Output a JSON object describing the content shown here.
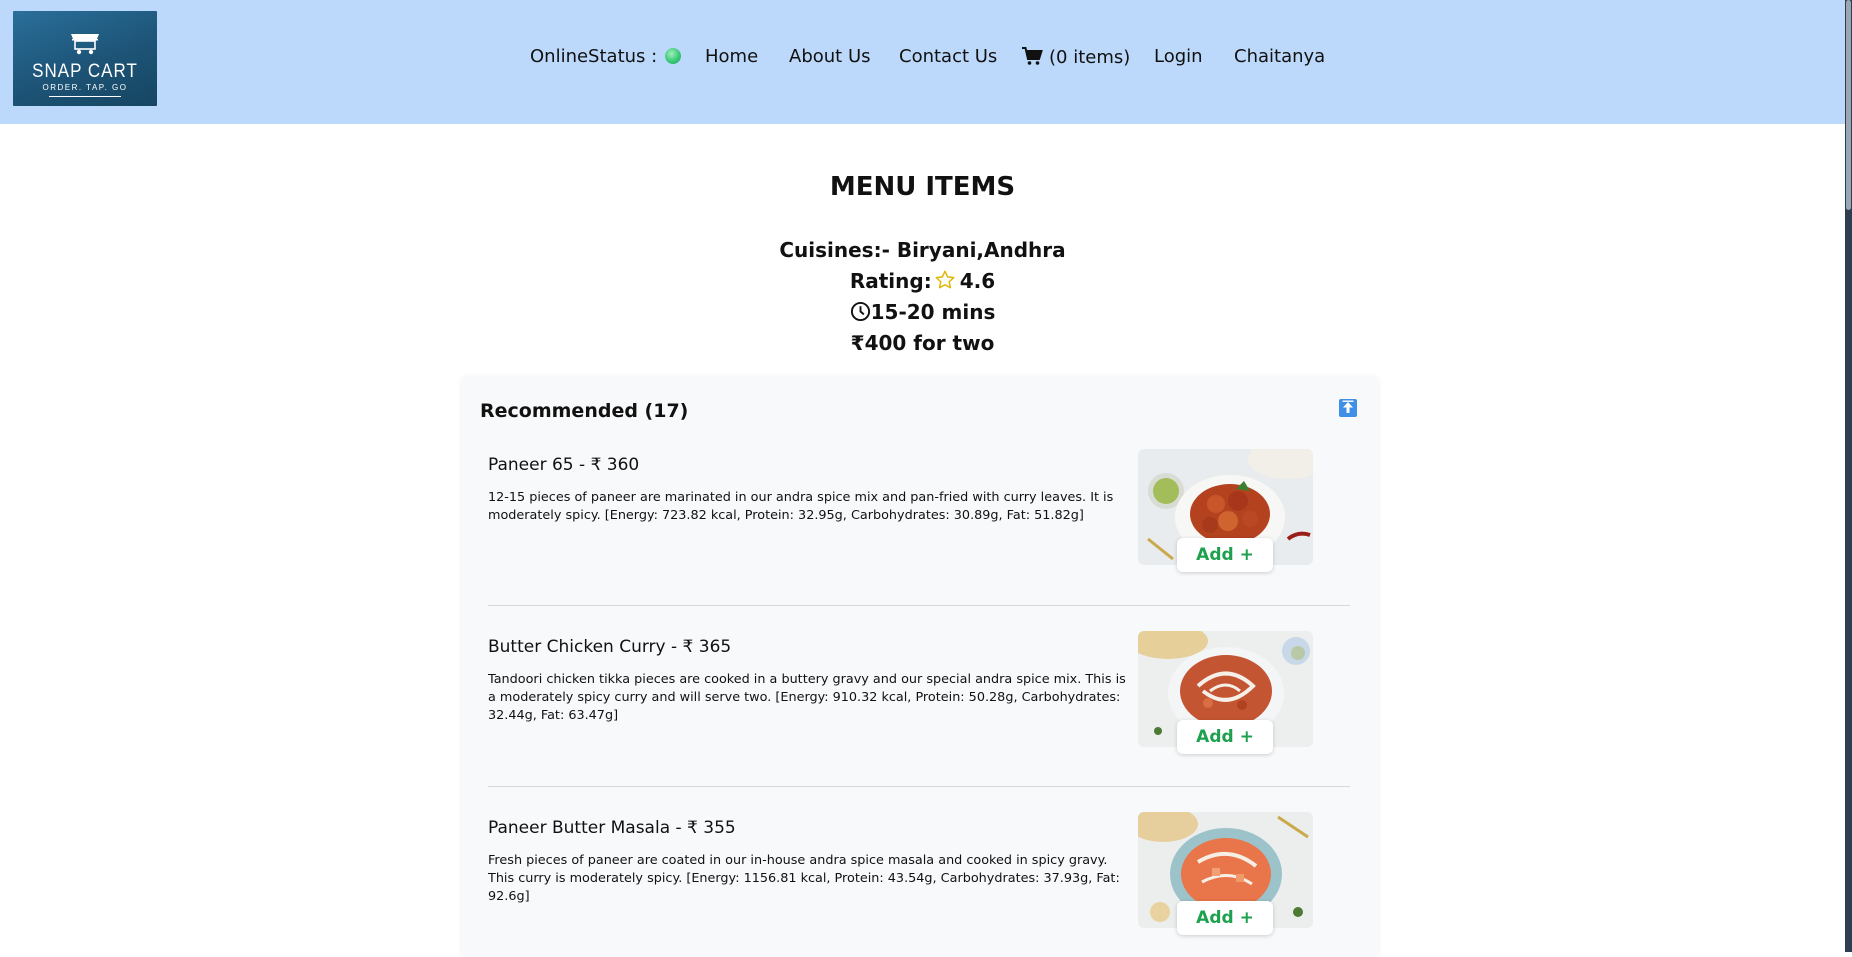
{
  "logo": {
    "title": "SNAP CART",
    "tagline": "ORDER. TAP. GO"
  },
  "nav": {
    "online_status_label": "OnlineStatus :",
    "home": "Home",
    "about": "About Us",
    "contact": "Contact Us",
    "cart": "(0 items)",
    "login": "Login",
    "user": "Chaitanya"
  },
  "menu": {
    "title": "MENU ITEMS",
    "cuisines": "Cuisines:- Biryani,Andhra",
    "rating_label": "Rating:",
    "rating_value": "4.6",
    "delivery_time": "15-20 mins",
    "cost_for_two": "₹400 for two"
  },
  "section": {
    "title": "Recommended (17)",
    "items": [
      {
        "name": "Paneer 65 - ₹ 360",
        "description": "12-15 pieces of paneer are marinated in our andra spice mix and pan-fried with curry leaves. It is moderately spicy. [Energy: 723.82 kcal, Protein: 32.95g, Carbohydrates: 30.89g, Fat: 51.82g]",
        "add_label": "Add +"
      },
      {
        "name": "Butter Chicken Curry - ₹ 365",
        "description": "Tandoori chicken tikka pieces are cooked in a buttery gravy and our special andra spice mix. This is a moderately spicy curry and will serve two. [Energy: 910.32 kcal, Protein: 50.28g, Carbohydrates: 32.44g, Fat: 63.47g]",
        "add_label": "Add +"
      },
      {
        "name": "Paneer Butter Masala - ₹ 355",
        "description": "Fresh pieces of paneer are coated in our in-house andra spice masala and cooked in spicy gravy. This curry is moderately spicy. [Energy: 1156.81 kcal, Protein: 43.54g, Carbohydrates: 37.93g, Fat: 92.6g]",
        "add_label": "Add +"
      }
    ]
  },
  "colors": {
    "header_bg": "#bcd9fb",
    "online_dot": "#3bc878",
    "add_text": "#1ea14f",
    "scroll_top_button": "#3f8fe6"
  },
  "icons": [
    "cart-icon",
    "star-icon",
    "clock-icon",
    "scroll-to-top-icon",
    "online-status-dot"
  ]
}
